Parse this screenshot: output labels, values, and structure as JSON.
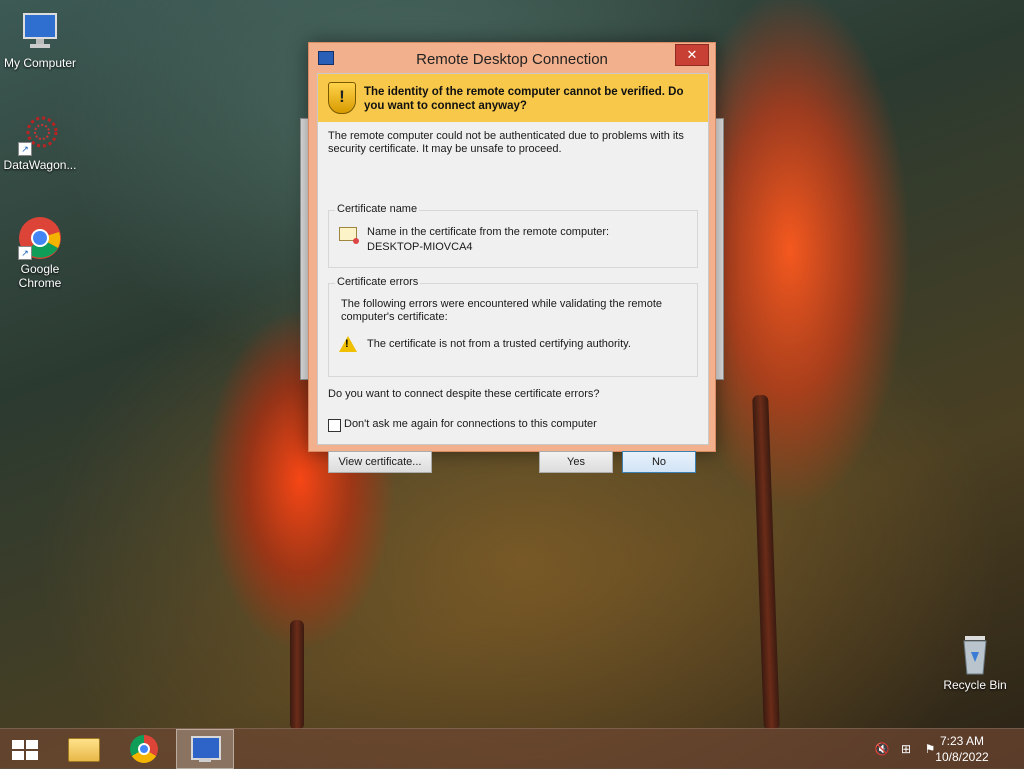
{
  "desktop": {
    "icons": [
      {
        "label": "My Computer"
      },
      {
        "label": "DataWagon..."
      },
      {
        "label": "Google Chrome"
      },
      {
        "label": "Recycle Bin"
      }
    ]
  },
  "dialog": {
    "title": "Remote Desktop Connection",
    "close_label": "✕",
    "banner_text": "The identity of the remote computer cannot be verified. Do you want to connect anyway?",
    "intro": "The remote computer could not be authenticated due to problems with its security certificate. It may be unsafe to proceed.",
    "cert_name_group": {
      "label": "Certificate name",
      "line1": "Name in the certificate from the remote computer:",
      "line2": "DESKTOP-MIOVCA4"
    },
    "cert_errors_group": {
      "label": "Certificate errors",
      "description": "The following errors were encountered while validating the remote computer's certificate:",
      "error1": "The certificate is not from a trusted certifying authority."
    },
    "question": "Do you want to connect despite these certificate errors?",
    "checkbox_label": "Don't ask me again for connections to this computer",
    "checkbox_checked": false,
    "buttons": {
      "view_certificate": "View certificate...",
      "yes": "Yes",
      "no": "No"
    }
  },
  "taskbar": {
    "time": "7:23 AM",
    "date": "10/8/2022"
  },
  "colors": {
    "dialog_frame": "#f3b08c",
    "banner": "#f7c84a",
    "close_button": "#c74033",
    "taskbar": "#6e4632"
  }
}
